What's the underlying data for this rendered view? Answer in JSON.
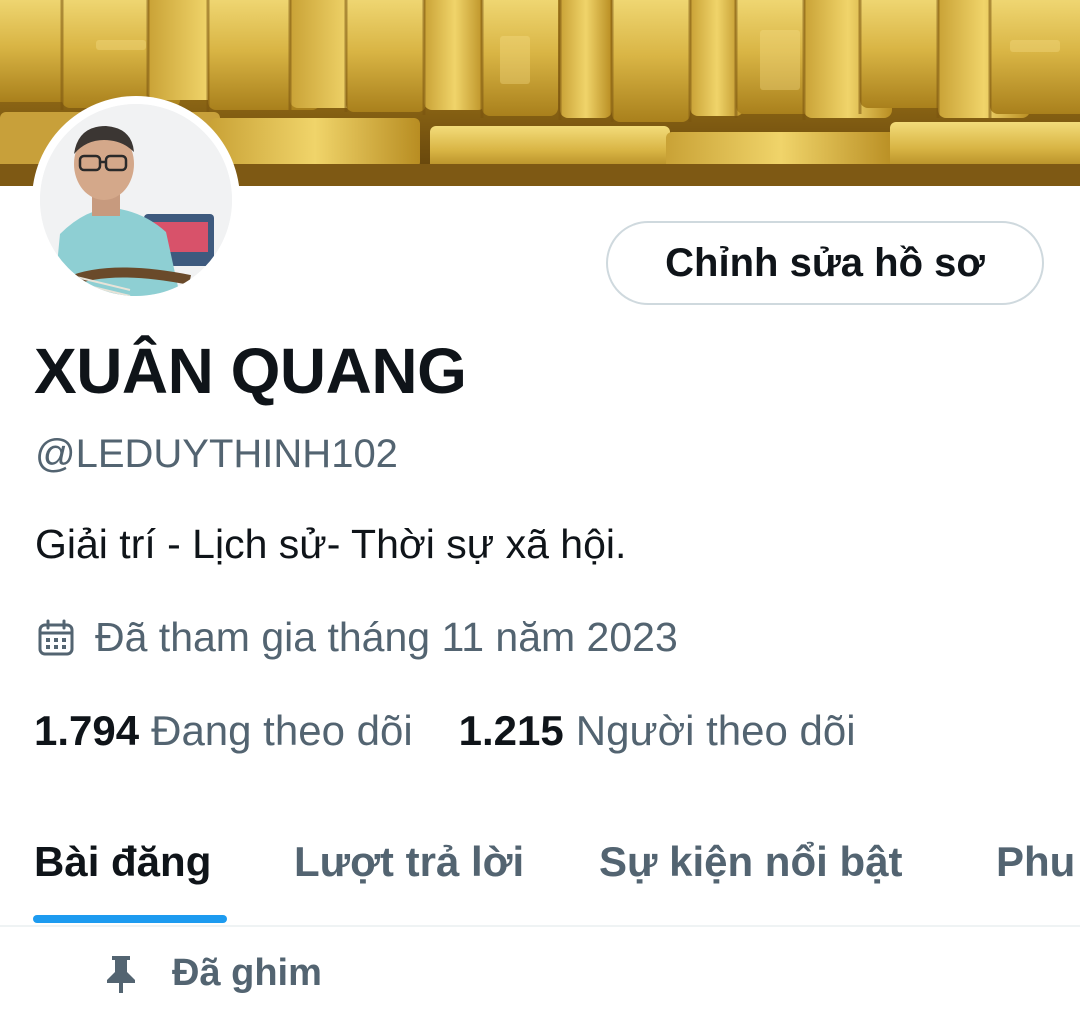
{
  "profile": {
    "display_name": "XUÂN QUANG",
    "handle": "@LEDUYTHINH102",
    "bio": "Giải trí - Lịch sử- Thời sự xã hội.",
    "joined": "Đã tham gia tháng 11 năm 2023",
    "edit_button": "Chỉnh sửa hồ sơ",
    "following_count": "1.794",
    "following_label": "Đang theo dõi",
    "followers_count": "1.215",
    "followers_label": "Người theo dõi"
  },
  "tabs": [
    {
      "label": "Bài đăng",
      "active": true
    },
    {
      "label": "Lượt trả lời",
      "active": false
    },
    {
      "label": "Sự kiện nổi bật",
      "active": false
    },
    {
      "label": "Phu",
      "active": false
    }
  ],
  "pinned_label": "Đã ghim",
  "icons": {
    "calendar": "calendar-icon",
    "pin": "pin-icon"
  },
  "colors": {
    "accent": "#1d9bf0",
    "text_primary": "#0f1419",
    "text_secondary": "#536471",
    "border": "#cfd9de"
  }
}
